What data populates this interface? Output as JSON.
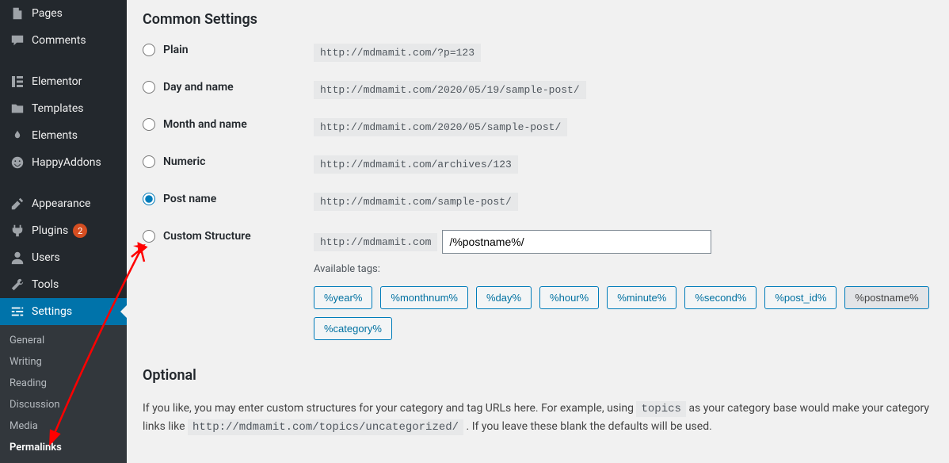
{
  "sidebar": {
    "items": [
      {
        "label": "Pages"
      },
      {
        "label": "Comments"
      },
      {
        "label": "Elementor"
      },
      {
        "label": "Templates"
      },
      {
        "label": "Elements"
      },
      {
        "label": "HappyAddons"
      },
      {
        "label": "Appearance"
      },
      {
        "label": "Plugins",
        "badge": "2"
      },
      {
        "label": "Users"
      },
      {
        "label": "Tools"
      },
      {
        "label": "Settings"
      }
    ],
    "sub": [
      {
        "label": "General"
      },
      {
        "label": "Writing"
      },
      {
        "label": "Reading"
      },
      {
        "label": "Discussion"
      },
      {
        "label": "Media"
      },
      {
        "label": "Permalinks"
      }
    ]
  },
  "section_title": "Common Settings",
  "options": {
    "plain": {
      "label": "Plain",
      "url": "http://mdmamit.com/?p=123"
    },
    "dayname": {
      "label": "Day and name",
      "url": "http://mdmamit.com/2020/05/19/sample-post/"
    },
    "monname": {
      "label": "Month and name",
      "url": "http://mdmamit.com/2020/05/sample-post/"
    },
    "numeric": {
      "label": "Numeric",
      "url": "http://mdmamit.com/archives/123"
    },
    "postname": {
      "label": "Post name",
      "url": "http://mdmamit.com/sample-post/"
    },
    "custom": {
      "label": "Custom Structure",
      "prefix": "http://mdmamit.com",
      "value": "/%postname%/"
    }
  },
  "available_label": "Available tags:",
  "tags": [
    "%year%",
    "%monthnum%",
    "%day%",
    "%hour%",
    "%minute%",
    "%second%",
    "%post_id%",
    "%postname%",
    "%category%"
  ],
  "active_tag": "%postname%",
  "optional_title": "Optional",
  "help": {
    "pre": "If you like, you may enter custom structures for your category and tag URLs here. For example, using ",
    "code1": "topics",
    "mid": " as your category base would make your category links like ",
    "code2": "http://mdmamit.com/topics/uncategorized/",
    "post": " . If you leave these blank the defaults will be used."
  }
}
